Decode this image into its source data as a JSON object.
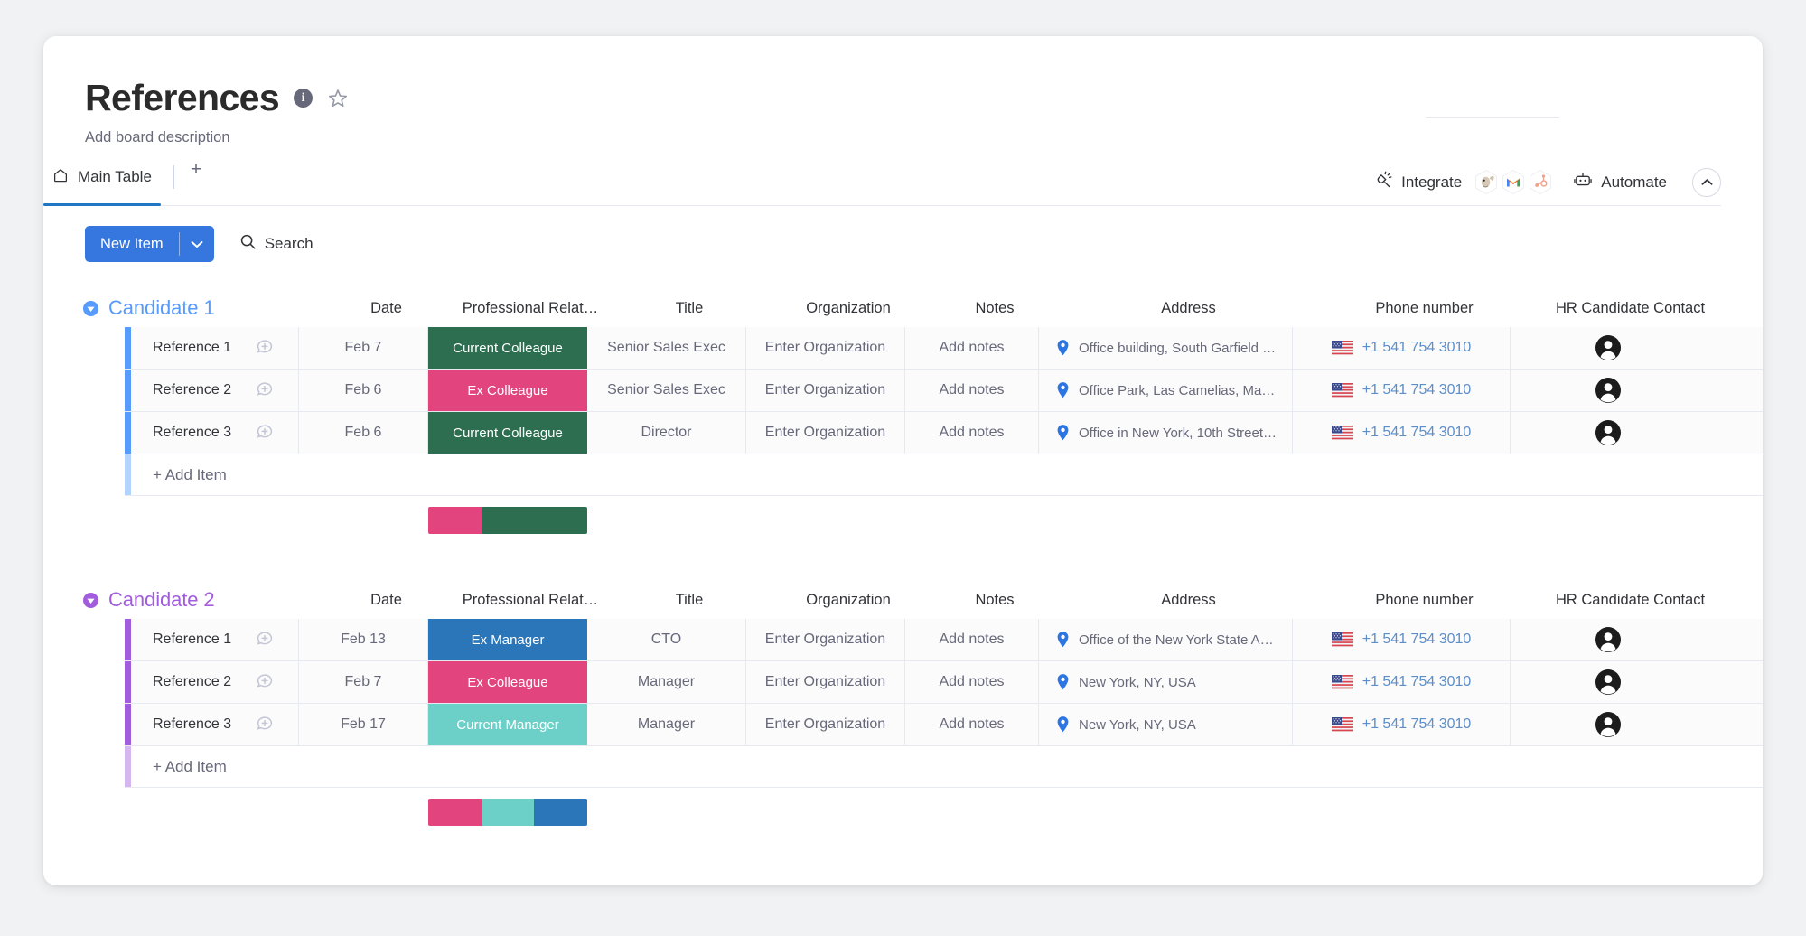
{
  "board": {
    "title": "References",
    "description": "Add board description",
    "info_icon": "info-icon",
    "star_icon": "star-icon"
  },
  "tabs": {
    "items": [
      {
        "label": "Main Table",
        "icon": "home-icon",
        "active": true
      }
    ],
    "add_label": "+"
  },
  "header_actions": {
    "integrate_label": "Integrate",
    "integrate_icon": "integrate-plug-icon",
    "automate_label": "Automate",
    "automate_icon": "robot-icon",
    "collapse_icon": "chevron-up-icon",
    "integrations": [
      "mailchimp-icon",
      "gmail-icon",
      "hubspot-icon"
    ]
  },
  "toolbar": {
    "new_item_label": "New Item",
    "new_item_caret": "chevron-down-icon",
    "search_label": "Search",
    "search_icon": "search-icon"
  },
  "columns": [
    {
      "key": "name",
      "label": ""
    },
    {
      "key": "date",
      "label": "Date"
    },
    {
      "key": "status",
      "label": "Professional Relat…"
    },
    {
      "key": "title",
      "label": "Title"
    },
    {
      "key": "org",
      "label": "Organization"
    },
    {
      "key": "notes",
      "label": "Notes"
    },
    {
      "key": "addr",
      "label": "Address"
    },
    {
      "key": "phone",
      "label": "Phone number"
    },
    {
      "key": "hr",
      "label": "HR Candidate Contact"
    }
  ],
  "colors": {
    "group1": "#579bfc",
    "group2": "#a25ddc",
    "status_current_colleague": "#2c6e4f",
    "status_ex_colleague": "#e2447e",
    "status_ex_manager": "#2b76b9",
    "status_current_manager": "#6dd0c8",
    "accent_blue": "#3577df",
    "link_blue": "#5c8ec9"
  },
  "add_item_label": "+ Add Item",
  "groups": [
    {
      "name": "Candidate 1",
      "color": "#579bfc",
      "toggle_icon": "collapse-arrow-icon",
      "rows": [
        {
          "name": "Reference 1",
          "chat_icon": "chat-add-icon",
          "date": "Feb 7",
          "status": "Current Colleague",
          "status_color": "#2c6e4f",
          "title": "Senior Sales Exec",
          "org": "Enter Organization",
          "notes": "Add notes",
          "address": "Office building, South Garfield …",
          "address_icon": "location-pin-icon",
          "phone": "+1 541 754 3010",
          "flag_icon": "us-flag-icon",
          "hr_contact_icon": "person-avatar-icon"
        },
        {
          "name": "Reference 2",
          "chat_icon": "chat-add-icon",
          "date": "Feb 6",
          "status": "Ex Colleague",
          "status_color": "#e2447e",
          "title": "Senior Sales Exec",
          "org": "Enter Organization",
          "notes": "Add notes",
          "address": "Office Park, Las Camelias, Ma…",
          "address_icon": "location-pin-icon",
          "phone": "+1 541 754 3010",
          "flag_icon": "us-flag-icon",
          "hr_contact_icon": "person-avatar-icon"
        },
        {
          "name": "Reference 3",
          "chat_icon": "chat-add-icon",
          "date": "Feb 6",
          "status": "Current Colleague",
          "status_color": "#2c6e4f",
          "title": "Director",
          "org": "Enter Organization",
          "notes": "Add notes",
          "address": "Office in New York, 10th Street…",
          "address_icon": "location-pin-icon",
          "phone": "+1 541 754 3010",
          "flag_icon": "us-flag-icon",
          "hr_contact_icon": "person-avatar-icon"
        }
      ],
      "summary": [
        {
          "color": "#e2447e",
          "fraction": 0.3333
        },
        {
          "color": "#2c6e4f",
          "fraction": 0.6667
        }
      ]
    },
    {
      "name": "Candidate 2",
      "color": "#a25ddc",
      "toggle_icon": "collapse-arrow-icon",
      "rows": [
        {
          "name": "Reference 1",
          "chat_icon": "chat-add-icon",
          "date": "Feb 13",
          "status": "Ex Manager",
          "status_color": "#2b76b9",
          "title": "CTO",
          "org": "Enter Organization",
          "notes": "Add notes",
          "address": "Office of the New York State A…",
          "address_icon": "location-pin-icon",
          "phone": "+1 541 754 3010",
          "flag_icon": "us-flag-icon",
          "hr_contact_icon": "person-avatar-icon"
        },
        {
          "name": "Reference 2",
          "chat_icon": "chat-add-icon",
          "date": "Feb 7",
          "status": "Ex Colleague",
          "status_color": "#e2447e",
          "title": "Manager",
          "org": "Enter Organization",
          "notes": "Add notes",
          "address": "New York, NY, USA",
          "address_icon": "location-pin-icon",
          "phone": "+1 541 754 3010",
          "flag_icon": "us-flag-icon",
          "hr_contact_icon": "person-avatar-icon"
        },
        {
          "name": "Reference 3",
          "chat_icon": "chat-add-icon",
          "date": "Feb 17",
          "status": "Current Manager",
          "status_color": "#6dd0c8",
          "title": "Manager",
          "org": "Enter Organization",
          "notes": "Add notes",
          "address": "New York, NY, USA",
          "address_icon": "location-pin-icon",
          "phone": "+1 541 754 3010",
          "flag_icon": "us-flag-icon",
          "hr_contact_icon": "person-avatar-icon"
        }
      ],
      "summary": [
        {
          "color": "#e2447e",
          "fraction": 0.3333
        },
        {
          "color": "#6dd0c8",
          "fraction": 0.3333
        },
        {
          "color": "#2b76b9",
          "fraction": 0.3334
        }
      ]
    }
  ]
}
